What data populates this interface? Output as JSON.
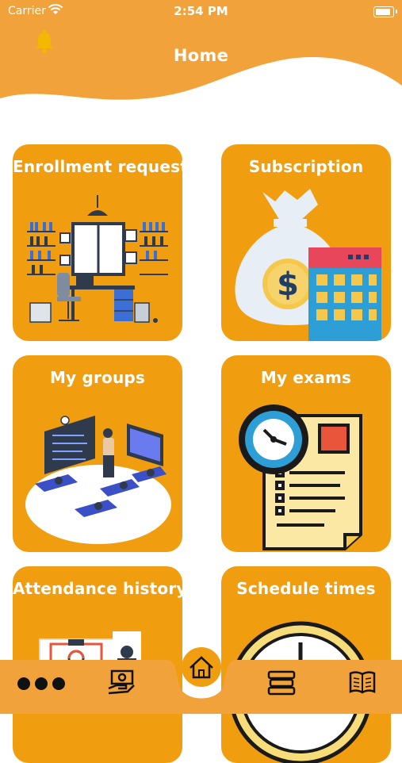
{
  "status_bar": {
    "carrier": "Carrier",
    "time": "2:54 PM"
  },
  "header": {
    "title": "Home",
    "bell_icon": "bell-icon"
  },
  "tiles": [
    {
      "label": "Enrollment requestes",
      "icon": "office-illustration"
    },
    {
      "label": "Subscription",
      "icon": "money-bag-calendar-illustration"
    },
    {
      "label": "My groups",
      "icon": "classroom-illustration"
    },
    {
      "label": "My exams",
      "icon": "clock-exam-sheet-illustration"
    },
    {
      "label": "Attendance history",
      "icon": "attendance-illustration"
    },
    {
      "label": "Schedule times",
      "icon": "clock-illustration"
    }
  ],
  "bottom_nav": [
    {
      "icon": "more-dots-icon"
    },
    {
      "icon": "money-hand-icon"
    },
    {
      "icon": "home-icon",
      "active": true
    },
    {
      "icon": "stack-icon"
    },
    {
      "icon": "open-book-icon"
    }
  ],
  "colors": {
    "primary": "#f09e10",
    "header": "#f2a23a",
    "white": "#ffffff"
  }
}
